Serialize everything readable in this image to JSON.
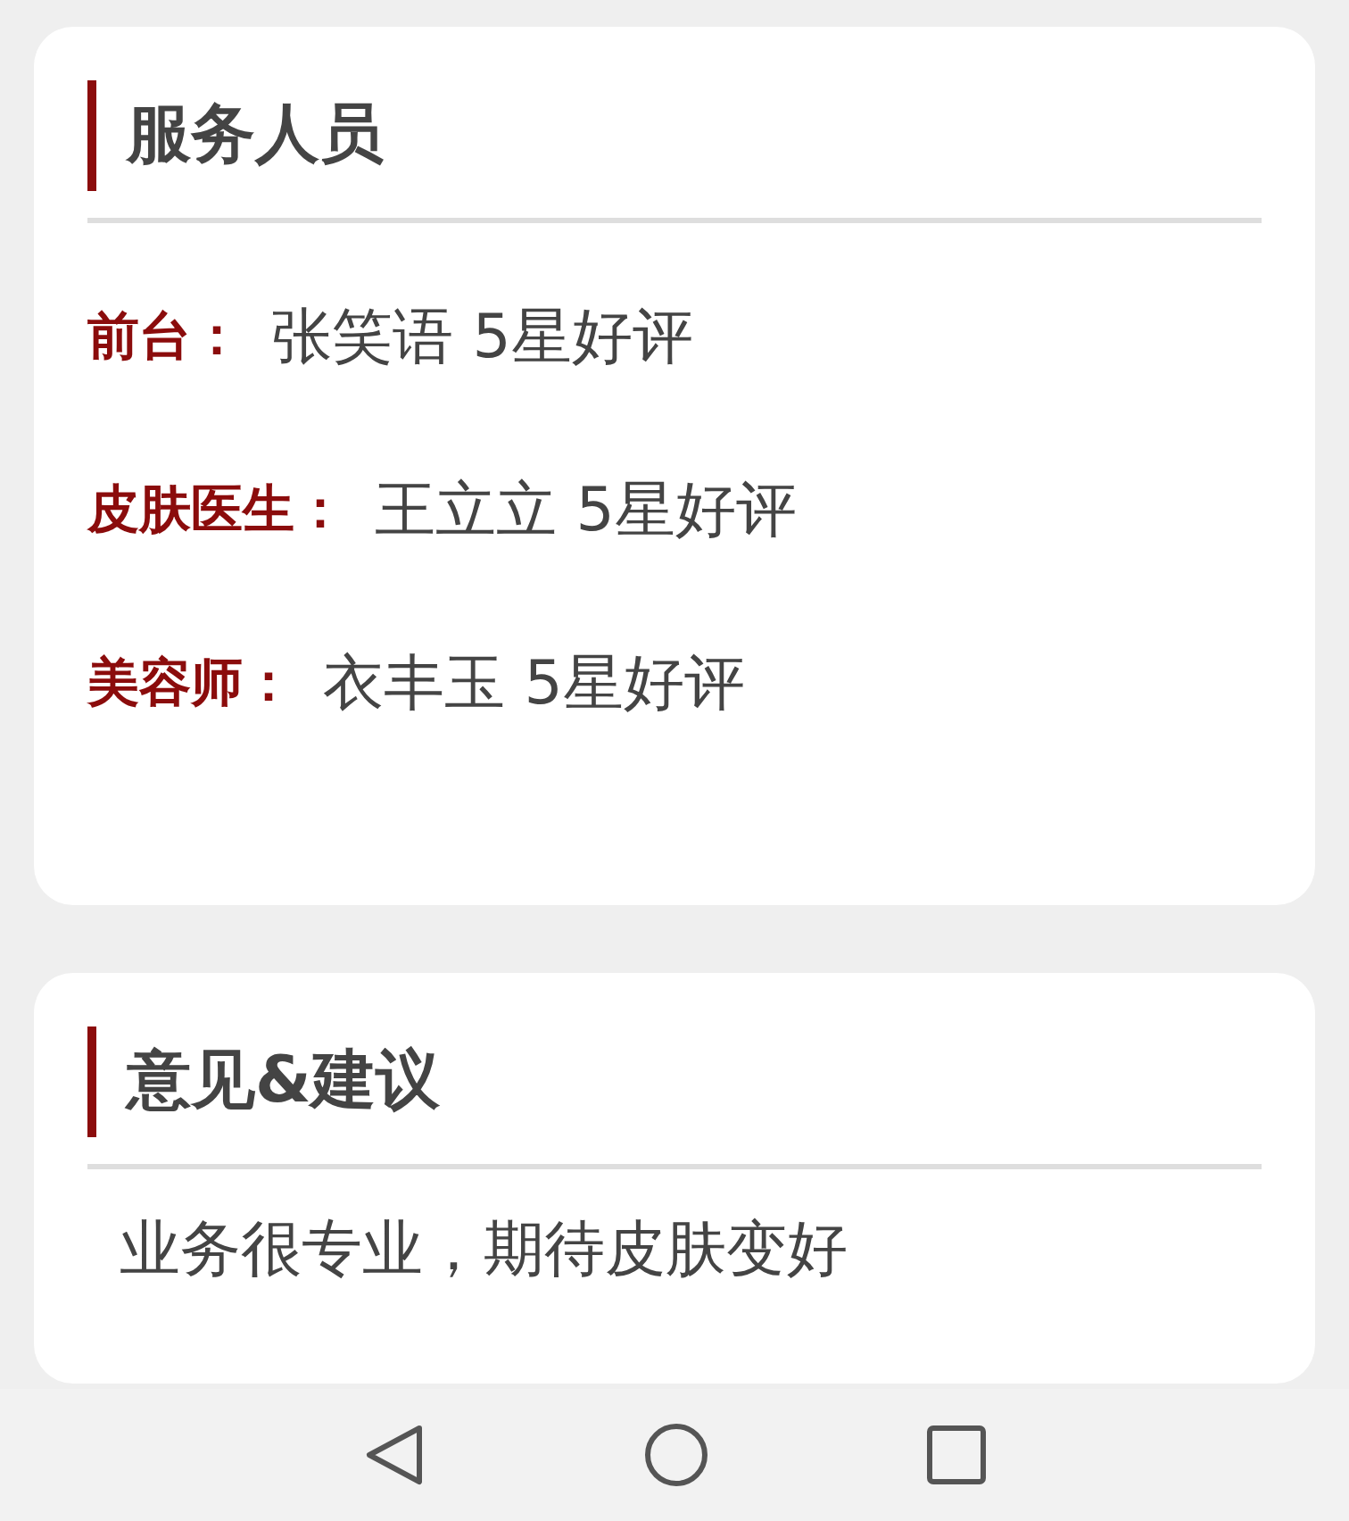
{
  "staff_card": {
    "title": "服务人员",
    "rows": [
      {
        "label": "前台：",
        "value": "张笑语 5星好评"
      },
      {
        "label": "皮肤医生：",
        "value": "王立立 5星好评"
      },
      {
        "label": "美容师：",
        "value": "衣丰玉 5星好评"
      }
    ]
  },
  "feedback_card": {
    "title": "意见&建议",
    "text": "业务很专业，期待皮肤变好"
  }
}
